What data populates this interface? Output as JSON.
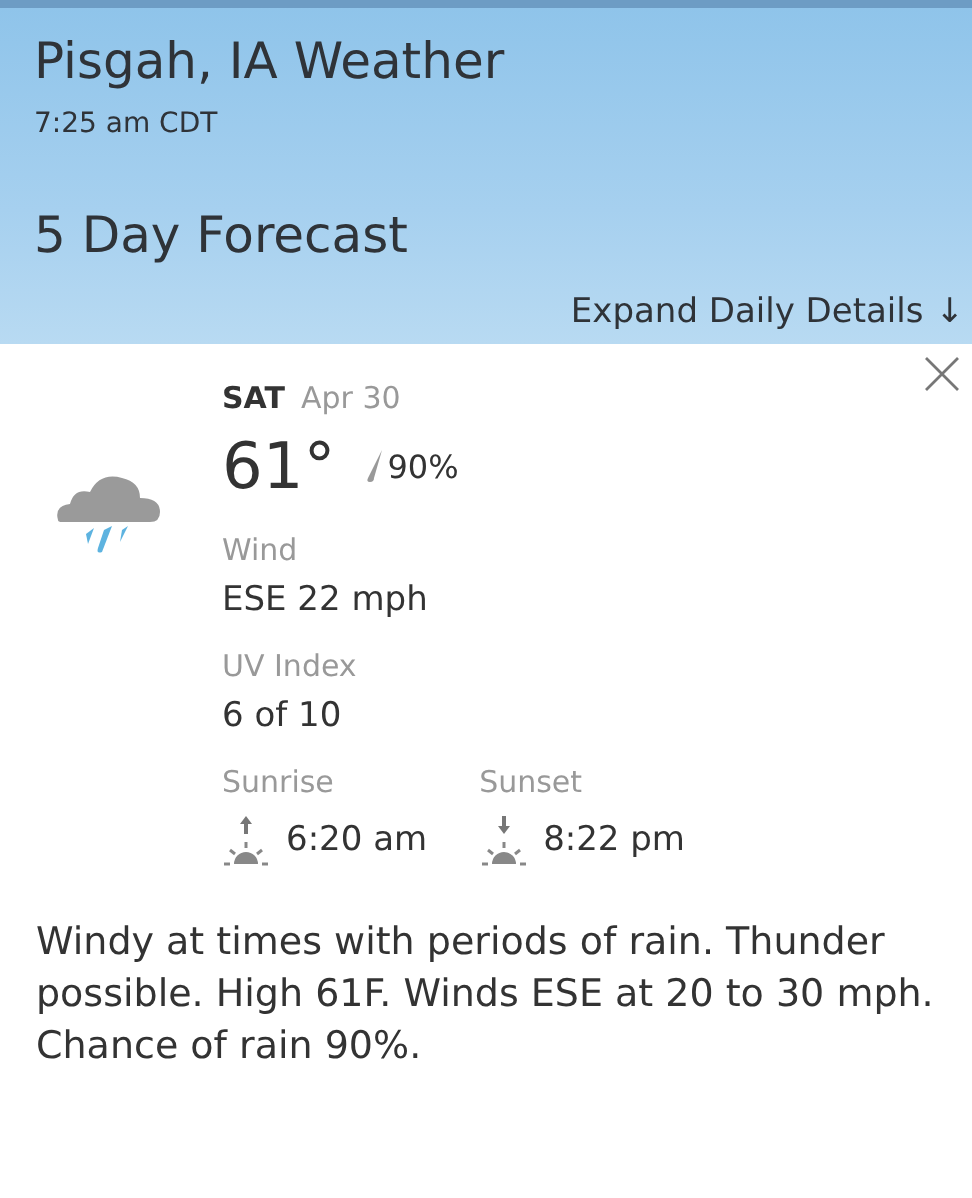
{
  "header": {
    "title": "Pisgah, IA Weather",
    "time": "7:25 am CDT",
    "section_title": "5 Day Forecast",
    "expand_link": "Expand Daily Details",
    "expand_arrow": "↓"
  },
  "day": {
    "weekday": "SAT",
    "date": "Apr 30",
    "temperature": "61°",
    "precip": "90%",
    "details": [
      {
        "label": "Wind",
        "value": "ESE 22 mph"
      },
      {
        "label": "UV Index",
        "value": "6 of 10"
      }
    ],
    "sun": [
      {
        "kind": "sunrise",
        "label": "Sunrise",
        "time": "6:20 am"
      },
      {
        "kind": "sunset",
        "label": "Sunset",
        "time": "8:22 pm"
      }
    ],
    "description": "Windy at times with periods of rain. Thunder possible. High 61F. Winds ESE at 20 to 30 mph. Chance of rain 90%."
  }
}
